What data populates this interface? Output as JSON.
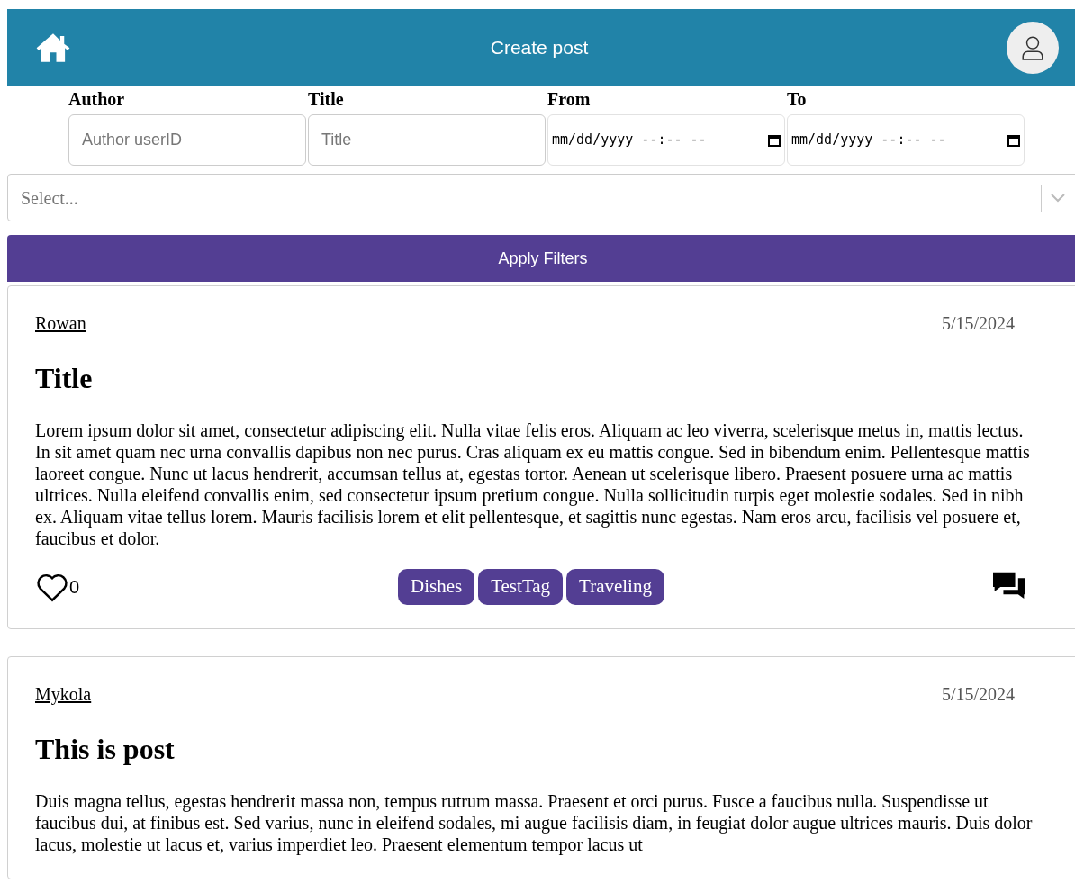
{
  "header": {
    "title": "Create post"
  },
  "filters": [
    {
      "label": "Author",
      "kind": "text",
      "placeholder": "Author userID"
    },
    {
      "label": "Title",
      "kind": "text",
      "placeholder": "Title"
    },
    {
      "label": "From",
      "kind": "datetime",
      "value": "mm/dd/yyyy --:-- --"
    },
    {
      "label": "To",
      "kind": "datetime",
      "value": "mm/dd/yyyy --:-- --"
    }
  ],
  "select": {
    "placeholder": "Select..."
  },
  "apply_button": "Apply Filters",
  "posts": [
    {
      "author": "Rowan",
      "date": "5/15/2024",
      "title": "Title",
      "body": "Lorem ipsum dolor sit amet, consectetur adipiscing elit. Nulla vitae felis eros. Aliquam ac leo viverra, scelerisque metus in, mattis lectus. In sit amet quam nec urna convallis dapibus non nec purus. Cras aliquam ex eu mattis congue. Sed in bibendum enim. Pellentesque mattis laoreet congue. Nunc ut lacus hendrerit, accumsan tellus at, egestas tortor. Aenean ut scelerisque libero. Praesent posuere urna ac mattis ultrices. Nulla eleifend convallis enim, sed consectetur ipsum pretium congue. Nulla sollicitudin turpis eget molestie sodales. Sed in nibh ex. Aliquam vitae tellus lorem. Mauris facilisis lorem et elit pellentesque, et sagittis nunc egestas. Nam eros arcu, facilisis vel posuere et, faucibus et dolor.",
      "likes": "0",
      "liked": false,
      "tags": [
        "Dishes",
        "TestTag",
        "Traveling"
      ]
    },
    {
      "author": "Mykola",
      "date": "5/15/2024",
      "title": "This is post",
      "body": "Duis magna tellus, egestas hendrerit massa non, tempus rutrum massa. Praesent et orci purus. Fusce a faucibus nulla. Suspendisse ut faucibus dui, at finibus est. Sed varius, nunc in eleifend sodales, mi augue facilisis diam, in feugiat dolor augue ultrices mauris. Duis dolor lacus, molestie ut lacus et, varius imperdiet leo. Praesent elementum tempor lacus ut"
    }
  ]
}
